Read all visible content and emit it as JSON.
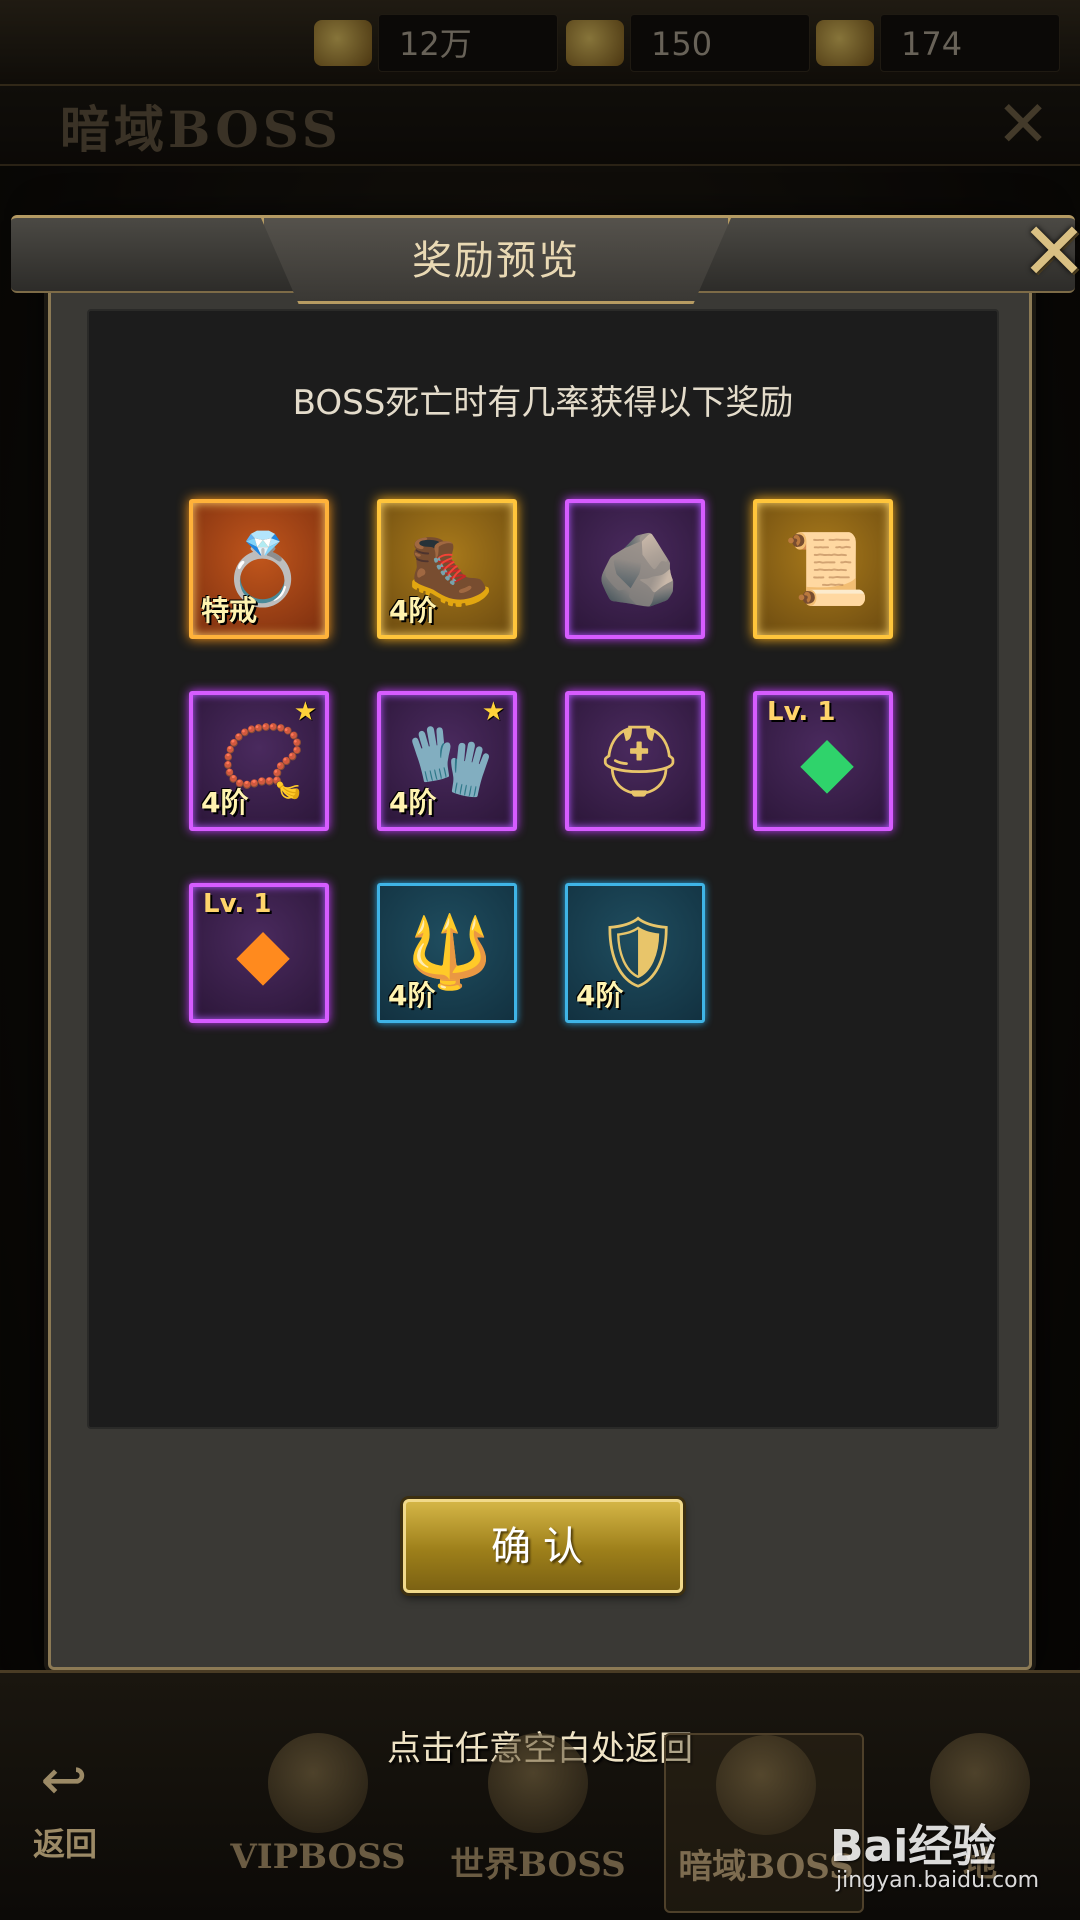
{
  "currencies": [
    {
      "icon": "gold-icon",
      "value": "12万"
    },
    {
      "icon": "ingot-icon",
      "value": "150"
    },
    {
      "icon": "yuanbao-icon",
      "value": "174"
    }
  ],
  "background": {
    "title": "暗域BOSS"
  },
  "dialog": {
    "title": "奖励预览",
    "description": "BOSS死亡时有几率获得以下奖励",
    "confirm_label": "确认",
    "rewards": [
      {
        "icon": "ring-icon",
        "quality": "orange",
        "tier": "特戒"
      },
      {
        "icon": "boots-icon",
        "quality": "gold",
        "tier": "4阶"
      },
      {
        "icon": "ore-icon",
        "quality": "purple"
      },
      {
        "icon": "scroll-icon",
        "quality": "gold"
      },
      {
        "icon": "necklace-icon",
        "quality": "purple",
        "tier": "4阶",
        "star": "★"
      },
      {
        "icon": "bracer-icon",
        "quality": "purple",
        "tier": "4阶",
        "star": "★"
      },
      {
        "icon": "helmet-icon",
        "quality": "purple"
      },
      {
        "icon": "green-gem-icon",
        "quality": "purple",
        "level": "Lv. 1"
      },
      {
        "icon": "orange-gem-icon",
        "quality": "purple",
        "level": "Lv. 1"
      },
      {
        "icon": "amulet-icon",
        "quality": "blue",
        "tier": "4阶"
      },
      {
        "icon": "armor-icon",
        "quality": "blue",
        "tier": "4阶"
      }
    ]
  },
  "bottom_nav": {
    "hint": "点击任意空白处返回",
    "back_label": "返回",
    "tabs": [
      {
        "label": "VIPBOSS"
      },
      {
        "label": "世界BOSS"
      },
      {
        "label": "暗域BOSS"
      },
      {
        "label": "地"
      }
    ]
  },
  "watermark": {
    "logo": "Bai经验",
    "url": "jingyan.baidu.com"
  }
}
